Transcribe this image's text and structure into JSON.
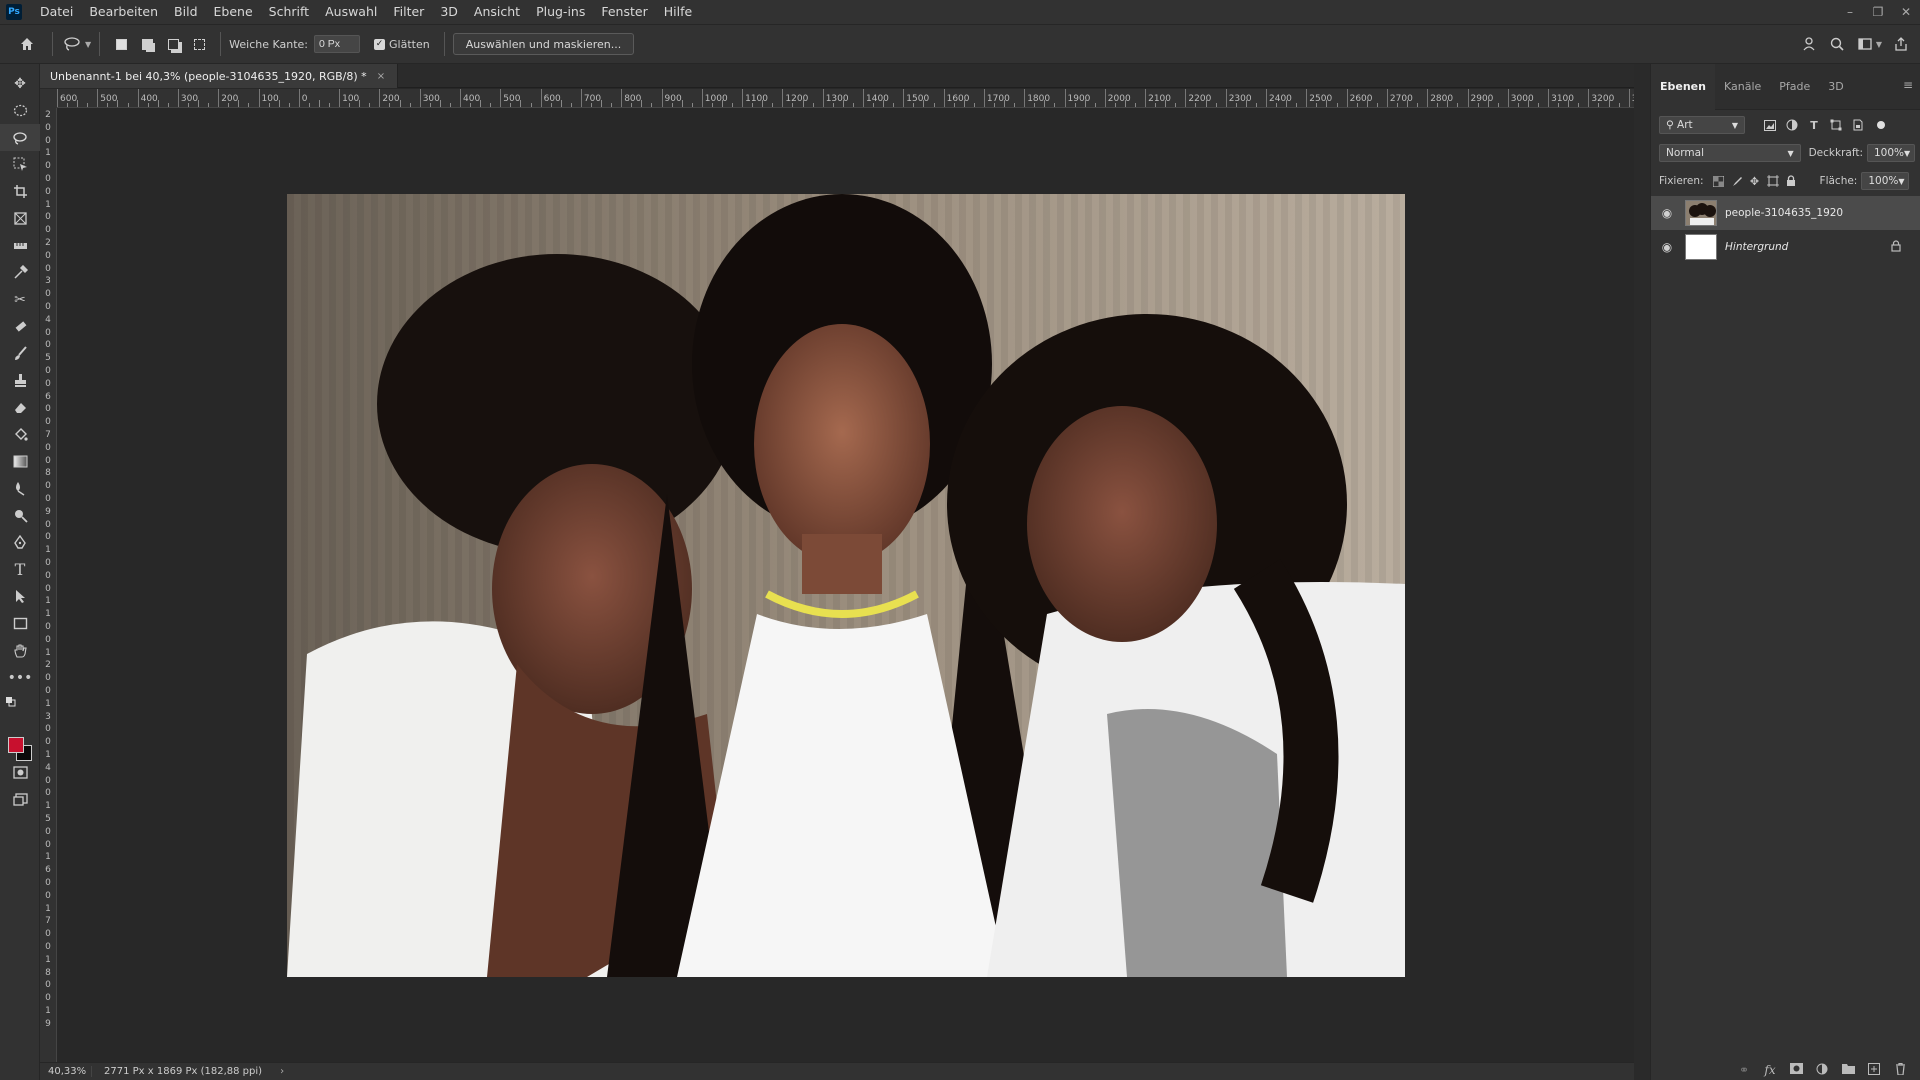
{
  "app": {
    "logo": "Ps",
    "menu": [
      "Datei",
      "Bearbeiten",
      "Bild",
      "Ebene",
      "Schrift",
      "Auswahl",
      "Filter",
      "3D",
      "Ansicht",
      "Plug-ins",
      "Fenster",
      "Hilfe"
    ],
    "window_controls": {
      "minimize": "–",
      "restore": "❐",
      "close": "✕"
    }
  },
  "options": {
    "feather_label": "Weiche Kante:",
    "feather_value": "0 Px",
    "antialias_label": "Glätten",
    "antialias_checked": true,
    "select_mask_label": "Auswählen und maskieren..."
  },
  "document": {
    "tab_title": "Unbenannt-1 bei 40,3% (people-3104635_1920, RGB/8) *",
    "close": "×"
  },
  "rulers": {
    "horizontal": [
      "600",
      "500",
      "400",
      "300",
      "200",
      "100",
      "0",
      "100",
      "200",
      "300",
      "400",
      "500",
      "600",
      "700",
      "800",
      "900",
      "1000",
      "1100",
      "1200",
      "1300",
      "1400",
      "1500",
      "1600",
      "1700",
      "1800",
      "1900",
      "2000",
      "2100",
      "2200",
      "2300",
      "2400",
      "2500",
      "2600",
      "2700",
      "2800",
      "2900",
      "3000",
      "3100",
      "3200",
      "33"
    ],
    "vertical": [
      "2",
      "0",
      "0",
      "1",
      "0",
      "0",
      "0",
      "1",
      "0",
      "0",
      "2",
      "0",
      "0",
      "3",
      "0",
      "0",
      "4",
      "0",
      "0",
      "5",
      "0",
      "0",
      "6",
      "0",
      "0",
      "7",
      "0",
      "0",
      "8",
      "0",
      "0",
      "9",
      "0",
      "0",
      "1",
      "0",
      "0",
      "0",
      "1",
      "1",
      "0",
      "0",
      "1",
      "2",
      "0",
      "0",
      "1",
      "3",
      "0",
      "0",
      "1",
      "4",
      "0",
      "0",
      "1",
      "5",
      "0",
      "0",
      "1",
      "6",
      "0",
      "0",
      "1",
      "7",
      "0",
      "0",
      "1",
      "8",
      "0",
      "0",
      "1",
      "9"
    ]
  },
  "status": {
    "zoom": "40,33%",
    "info": "2771 Px x 1869 Px (182,88 ppi)",
    "arrow": "›"
  },
  "colors": {
    "foreground": "#c8102e",
    "background": "#0a0a0a"
  },
  "layers_panel": {
    "tabs": [
      "Ebenen",
      "Kanäle",
      "Pfade",
      "3D"
    ],
    "filter_type": "Art",
    "blend_mode": "Normal",
    "opacity_label": "Deckkraft:",
    "opacity_value": "100%",
    "lock_label": "Fixieren:",
    "fill_label": "Fläche:",
    "fill_value": "100%",
    "layers": [
      {
        "name": "people-3104635_1920",
        "selected": true,
        "visible": true
      },
      {
        "name": "Hintergrund",
        "selected": false,
        "visible": true,
        "locked": true
      }
    ]
  }
}
